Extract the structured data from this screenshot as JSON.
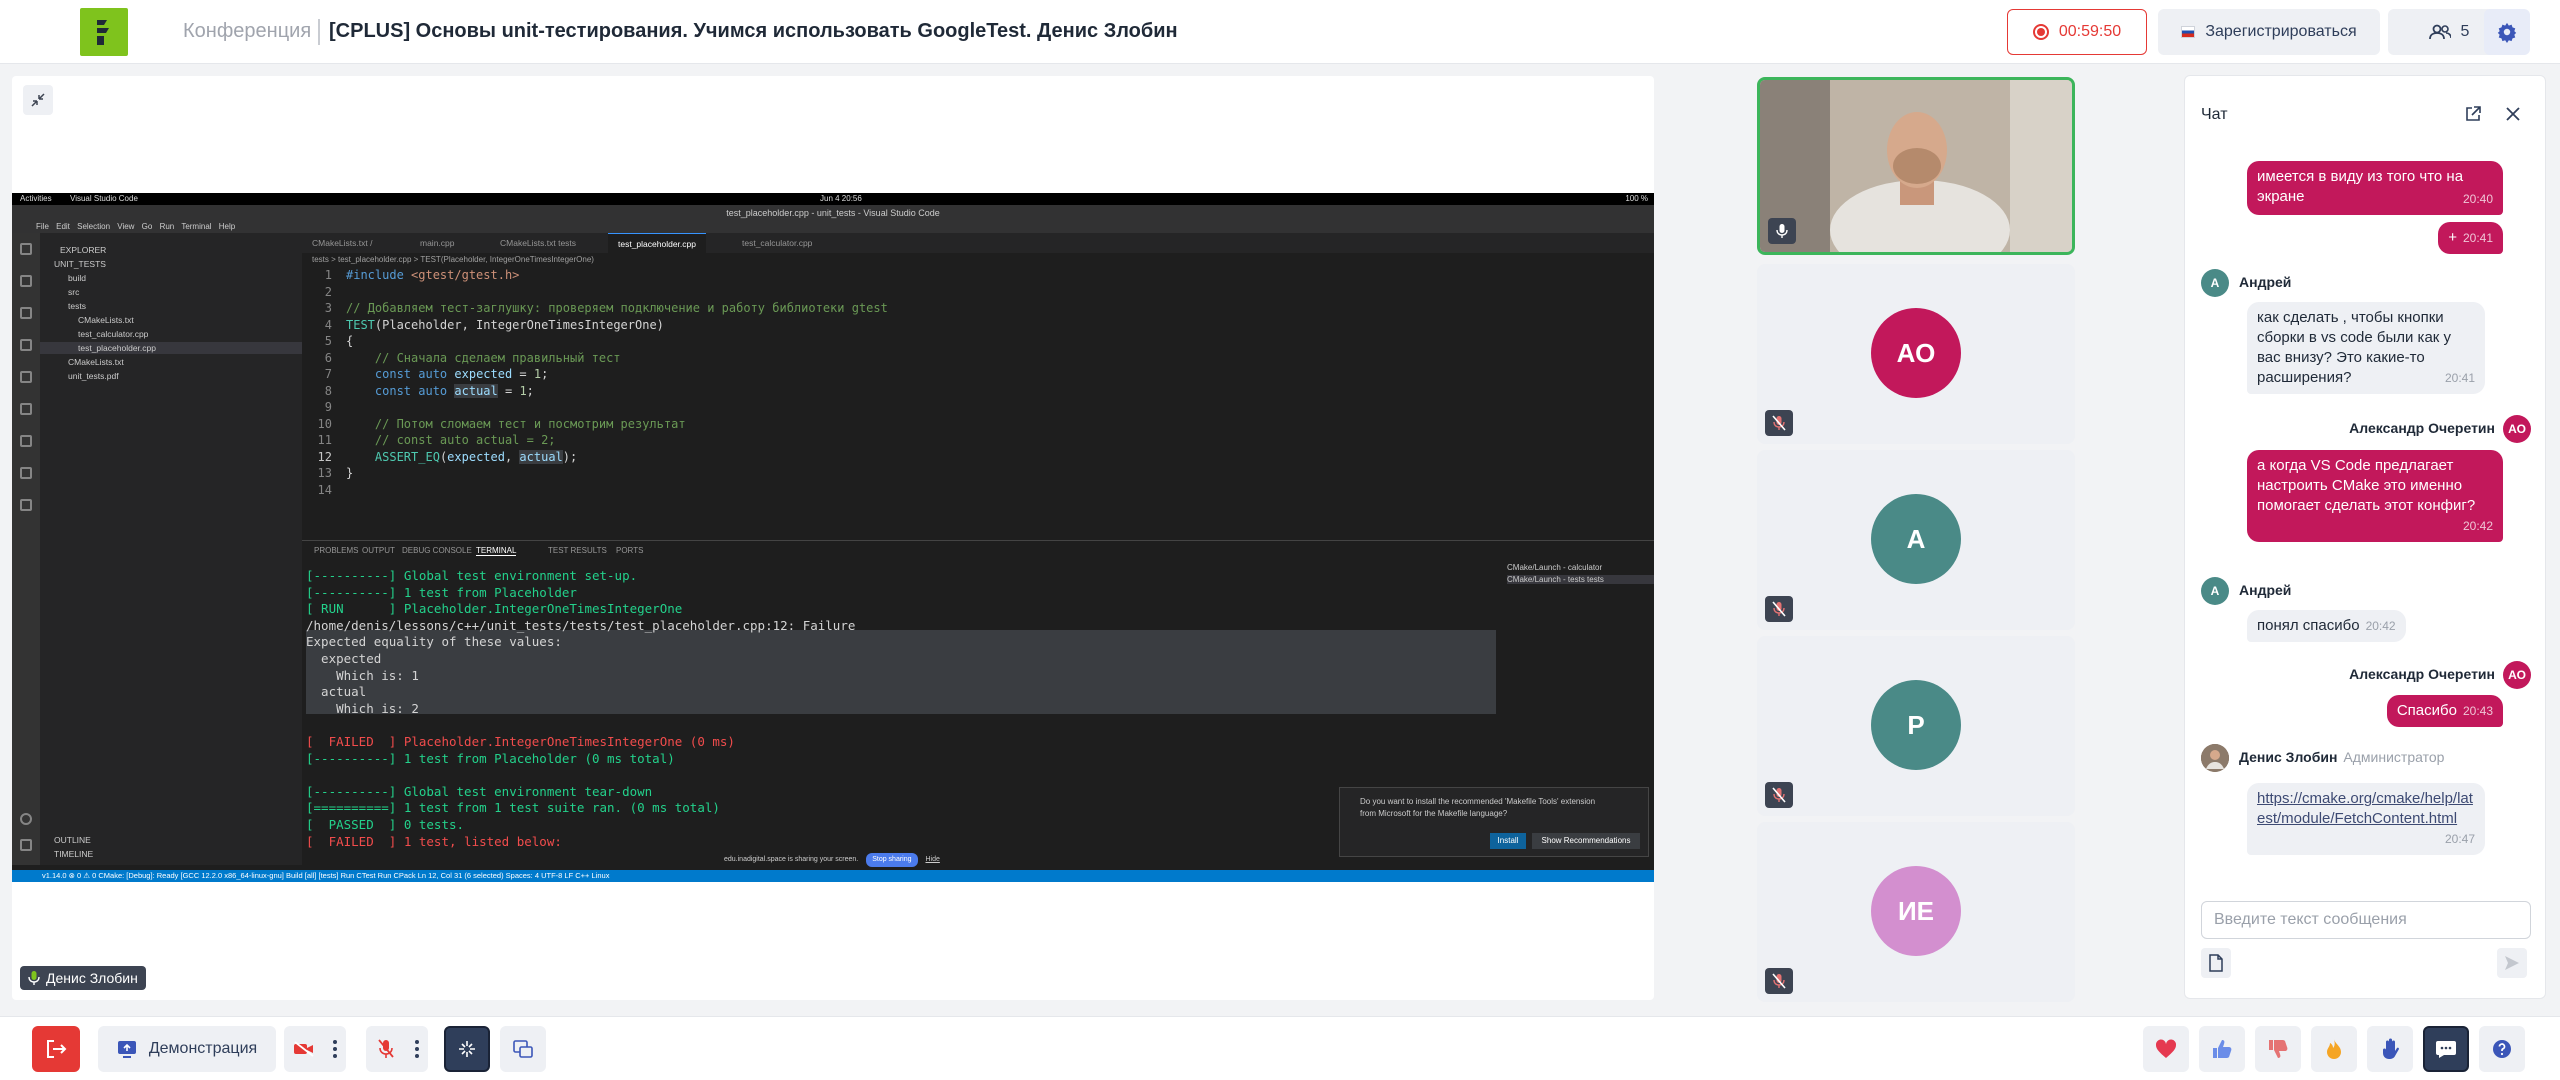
{
  "header": {
    "conference_label": "Конференция",
    "title": "[CPLUS] Основы unit-тестирования. Учимся использовать GoogleTest. Денис Злобин",
    "recording_time": "00:59:50",
    "register_label": "Зарегистрироваться",
    "participants_count": "5"
  },
  "screen_share": {
    "os_bar": {
      "activities": "Activities",
      "app": "Visual Studio Code",
      "date": "Jun 4  20:56",
      "battery": "100 %"
    },
    "window_title": "test_placeholder.cpp - unit_tests - Visual Studio Code",
    "menu": "File Edit Selection View Go Run Terminal Help",
    "explorer": {
      "header": "EXPLORER",
      "root": "UNIT_TESTS",
      "items": [
        "build",
        "src",
        "tests",
        "CMakeLists.txt",
        "test_calculator.cpp",
        "test_placeholder.cpp",
        "CMakeLists.txt",
        "unit_tests.pdf"
      ],
      "outline": "OUTLINE",
      "timeline": "TIMELINE"
    },
    "tabs": [
      "CMakeLists.txt  /",
      "main.cpp",
      "CMakeLists.txt  tests",
      "test_placeholder.cpp",
      "test_calculator.cpp"
    ],
    "breadcrumb": "tests > test_placeholder.cpp > TEST(Placeholder, IntegerOneTimesIntegerOne)",
    "code_lines": [
      "#include <gtest/gtest.h>",
      "",
      "// Добавляем тест-заглушку: проверяем подключение и работу библиотеки gtest",
      "TEST(Placeholder, IntegerOneTimesIntegerOne)",
      "{",
      "    // Сначала сделаем правильный тест",
      "    const auto expected = 1;",
      "    const auto actual = 1;",
      "",
      "    // Потом сломаем тест и посмотрим результат",
      "    // const auto actual = 2;",
      "    ASSERT_EQ(expected, actual);",
      "}",
      ""
    ],
    "panel_tabs": [
      "PROBLEMS",
      "OUTPUT",
      "DEBUG CONSOLE",
      "TERMINAL",
      "TEST RESULTS",
      "PORTS"
    ],
    "terminal_lines": [
      "[----------] Global test environment set-up.",
      "[----------] 1 test from Placeholder",
      "[ RUN      ] Placeholder.IntegerOneTimesIntegerOne",
      "/home/denis/lessons/c++/unit_tests/tests/test_placeholder.cpp:12: Failure",
      "Expected equality of these values:",
      "  expected",
      "    Which is: 1",
      "  actual",
      "    Which is: 2",
      "",
      "[  FAILED  ] Placeholder.IntegerOneTimesIntegerOne (0 ms)",
      "[----------] 1 test from Placeholder (0 ms total)",
      "",
      "[----------] Global test environment tear-down",
      "[==========] 1 test from 1 test suite ran. (0 ms total)",
      "[  PASSED  ] 0 tests.",
      "[  FAILED  ] 1 test, listed below:"
    ],
    "terminal_list": [
      "CMake/Launch - calculator",
      "CMake/Launch - tests  tests"
    ],
    "notification": {
      "text": "Do you want to install the recommended 'Makefile Tools' extension from Microsoft for the Makefile language?",
      "install": "Install",
      "show": "Show Recommendations"
    },
    "sharing": {
      "text": "edu.inadigital.space is sharing your screen.",
      "stop": "Stop sharing",
      "hide": "Hide"
    },
    "status_bar": "v1.14.0    ⊗ 0 ⚠ 0    CMake: [Debug]: Ready    [GCC 12.2.0 x86_64-linux-gnu]    Build  [all]    [tests]    Run CTest    Run CPack              Ln 12, Col 31 (6 selected)   Spaces: 4   UTF-8   LF   C++   Linux"
  },
  "speaker": {
    "name": "Денис Злобин"
  },
  "tiles": [
    {
      "initials": "АО",
      "color": "#c2185b"
    },
    {
      "initials": "А",
      "color": "#4a8a87"
    },
    {
      "initials": "Р",
      "color": "#4a8a87"
    },
    {
      "initials": "ИЕ",
      "color": "#d38fcf"
    }
  ],
  "chat": {
    "title": "Чат",
    "messages": [
      {
        "text": "имеется в виду из того что на экране",
        "time": "20:40"
      },
      {
        "text": "+",
        "time": "20:41"
      },
      {
        "author": "Андрей",
        "initial": "А",
        "text": "как сделать , чтобы кнопки сборки  в vs code были как у вас внизу? Это какие-то расширения?",
        "time": "20:41"
      },
      {
        "author": "Александр Очеретин",
        "initial": "АО",
        "text": "а когда VS Code предлагает настроить CMake это именно помогает сделать этот конфиг?",
        "time": "20:42"
      },
      {
        "author": "Андрей",
        "initial": "А",
        "text": "понял спасибо",
        "time": "20:42"
      },
      {
        "author": "Александр Очеретин",
        "initial": "АО",
        "text": "Спасибо",
        "time": "20:43"
      },
      {
        "author": "Денис Злобин",
        "role": "Администратор",
        "text": "https://cmake.org/cmake/help/latest/module/FetchContent.html",
        "time": "20:47"
      }
    ],
    "input_placeholder": "Введите текст сообщения"
  },
  "bottom": {
    "demo_label": "Демонстрация"
  },
  "colors": {
    "brand_green": "#7fc31d",
    "accent_red": "#e53935",
    "chat_out": "#c2185b",
    "dark_navy": "#2f3e5a"
  }
}
